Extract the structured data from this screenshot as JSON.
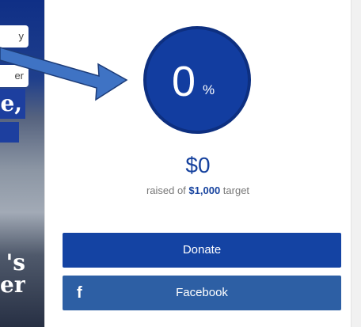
{
  "hero": {
    "pill_1": "y",
    "pill_2": "er",
    "headline_fragment": "e,",
    "serif_line_1": "'s",
    "serif_line_2": "er"
  },
  "campaign": {
    "progress_value": "0",
    "progress_unit": "%",
    "progress_fraction": 0,
    "raised_amount": "$0",
    "raised_prefix": "raised of ",
    "target_amount": "$1,000",
    "raised_suffix": " target"
  },
  "actions": {
    "donate_label": "Donate",
    "facebook_label": "Facebook",
    "facebook_icon": "f"
  },
  "colors": {
    "primary": "#1443a3",
    "facebook": "#2d5fa4",
    "annotation_arrow": "#3f73c4"
  }
}
